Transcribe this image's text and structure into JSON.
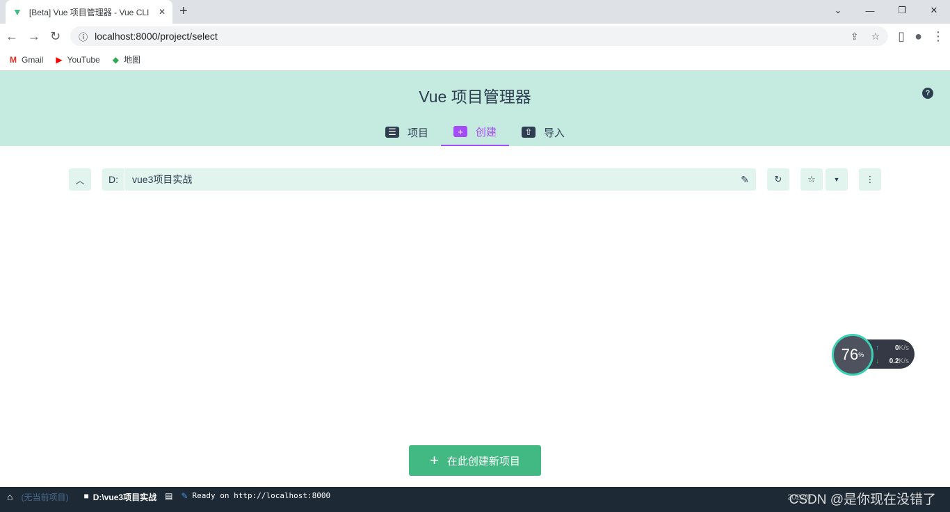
{
  "browser": {
    "tab_title": "[Beta] Vue 项目管理器 - Vue CLI",
    "url": "localhost:8000/project/select",
    "bookmarks": [
      {
        "label": "Gmail"
      },
      {
        "label": "YouTube"
      },
      {
        "label": "地图"
      }
    ]
  },
  "app": {
    "title": "Vue 项目管理器",
    "tabs": [
      {
        "label": "项目",
        "icon": "list-icon"
      },
      {
        "label": "创建",
        "icon": "plus-box-icon",
        "active": true
      },
      {
        "label": "导入",
        "icon": "import-icon"
      }
    ],
    "path": {
      "drive": "D:",
      "folder": "vue3项目实战"
    },
    "create_button": "在此创建新项目"
  },
  "statusbar": {
    "project": "(无当前项目)",
    "folder": "D:\\vue3项目实战",
    "log": "Ready on http://localhost:8000",
    "date": "2022/0",
    "watermark": "CSDN @是你现在没错了"
  },
  "net_widget": {
    "percent": "76",
    "unit": "%",
    "up": "0",
    "down": "0.2",
    "speed_unit": "K/s"
  },
  "colors": {
    "accent": "#a44cf6",
    "primary": "#42b983",
    "header_bg": "#c5eadf"
  }
}
